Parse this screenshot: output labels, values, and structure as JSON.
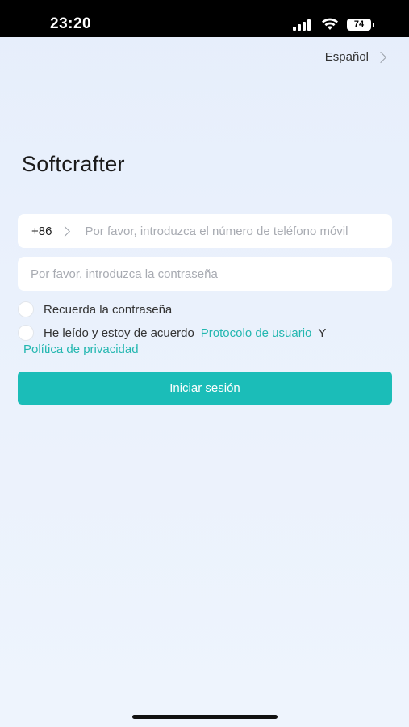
{
  "status_bar": {
    "time": "23:20",
    "battery": "74",
    "icons": [
      "signal-icon",
      "wifi-icon",
      "battery-icon"
    ]
  },
  "language_selector": {
    "label": "Español"
  },
  "app": {
    "title": "Softcrafter"
  },
  "login_form": {
    "country_code": "+86",
    "phone_placeholder": "Por favor, introduzca el número de teléfono móvil",
    "password_placeholder": "Por favor, introduzca la contraseña",
    "remember_label": "Recuerda la contraseña",
    "agree_text": "He leído y estoy de acuerdo",
    "user_protocol_link": "Protocolo de usuario",
    "conjunction": "Y",
    "privacy_policy_link": "Política de privacidad",
    "login_button": "Iniciar sesión"
  },
  "colors": {
    "accent": "#1bbdb8",
    "link": "#23b7b0",
    "background": "#e8f0fc"
  }
}
